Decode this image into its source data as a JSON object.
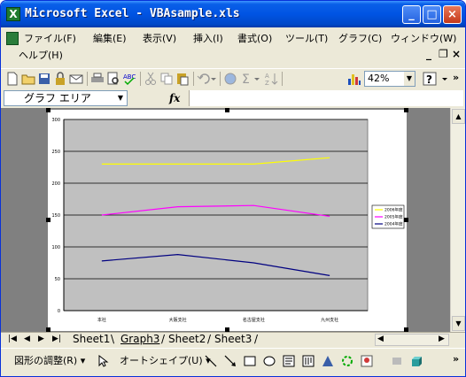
{
  "window": {
    "title": "Microsoft Excel - VBAsample.xls",
    "app_icon": "excel-icon",
    "caption_buttons": [
      "minimize-icon",
      "maximize-icon",
      "close-icon"
    ]
  },
  "menubar": {
    "items": [
      "ファイル(F)",
      "編集(E)",
      "表示(V)",
      "挿入(I)",
      "書式(O)",
      "ツール(T)",
      "グラフ(C)",
      "ウィンドウ(W)",
      "ヘルプ(H)"
    ]
  },
  "toolbar": {
    "zoom": "42%",
    "more": "»"
  },
  "formula_bar": {
    "name_box": "グラフ エリア",
    "fx": "fx",
    "value": ""
  },
  "colors": {
    "plot_area": "#c0c0c0",
    "series_2006": "#ffff00",
    "series_2005": "#ff00ff",
    "series_2004": "#000080",
    "titlebar": "#0054e3"
  },
  "chart_data": {
    "type": "line",
    "categories": [
      "本社",
      "大阪支社",
      "名古屋支社",
      "九州支社"
    ],
    "series": [
      {
        "name": "2006年度",
        "values": [
          230,
          230,
          230,
          240
        ]
      },
      {
        "name": "2005年度",
        "values": [
          150,
          163,
          165,
          148
        ]
      },
      {
        "name": "2004年度",
        "values": [
          78,
          88,
          75,
          55
        ]
      }
    ],
    "ylim": [
      0,
      300
    ],
    "yticks": [
      "0",
      "50",
      "100",
      "150",
      "200",
      "250",
      "300"
    ],
    "grid": true,
    "legend": "right"
  },
  "sheet_tabs": {
    "tabs": [
      "Sheet1",
      "Graph3",
      "Sheet2",
      "Sheet3"
    ],
    "active": "Graph3"
  },
  "drawing_toolbar": {
    "draw_menu": "図形の調整(R)",
    "autoshapes_menu": "オートシェイプ(U)",
    "more": "»"
  }
}
